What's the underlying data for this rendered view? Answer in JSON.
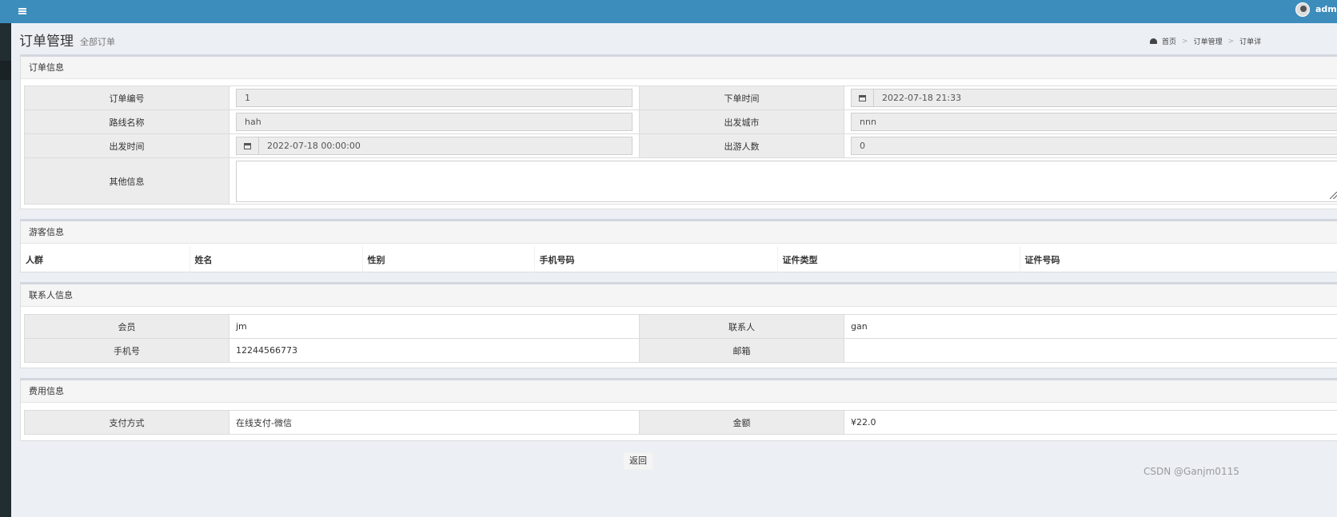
{
  "topbar": {
    "user_name": "admi"
  },
  "page": {
    "title": "订单管理",
    "subtitle": "全部订单"
  },
  "breadcrumb": {
    "items": [
      "首页",
      "订单管理",
      "订单详"
    ]
  },
  "order_info": {
    "header": "订单信息",
    "order_no_label": "订单编号",
    "order_no": "1",
    "order_time_label": "下单时间",
    "order_time": "2022-07-18 21:33",
    "route_label": "路线名称",
    "route": "hah",
    "city_label": "出发城市",
    "city": "nnn",
    "depart_label": "出发时间",
    "depart": "2022-07-18 00:00:00",
    "people_label": "出游人数",
    "people": "0",
    "other_label": "其他信息",
    "other": ""
  },
  "tourist_info": {
    "header": "游客信息",
    "columns": [
      "人群",
      "姓名",
      "性别",
      "手机号码",
      "证件类型",
      "证件号码"
    ]
  },
  "contact_info": {
    "header": "联系人信息",
    "member_label": "会员",
    "member": "jm",
    "contact_label": "联系人",
    "contact": "gan",
    "phone_label": "手机号",
    "phone": "12244566773",
    "email_label": "邮箱",
    "email": ""
  },
  "fee_info": {
    "header": "费用信息",
    "pay_label": "支付方式",
    "pay": "在线支付-微信",
    "amount_label": "金额",
    "amount": "¥22.0"
  },
  "actions": {
    "back": "返回"
  },
  "watermark": "CSDN @Ganjm0115",
  "colors": {
    "topbar": "#3c8dbc",
    "sidebar": "#222d32",
    "background": "#ecf0f5"
  }
}
